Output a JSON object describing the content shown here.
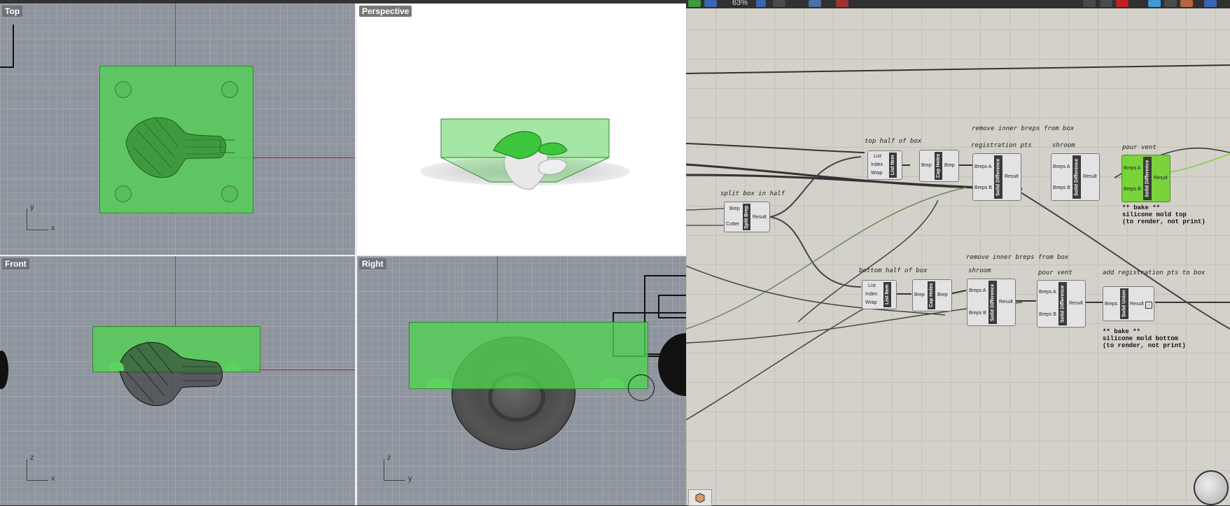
{
  "viewports": {
    "top": {
      "label": "Top",
      "axis1": "y",
      "axis2": "x"
    },
    "perspective": {
      "label": "Perspective"
    },
    "front": {
      "label": "Front",
      "axis1": "z",
      "axis2": "x"
    },
    "right": {
      "label": "Right",
      "axis1": "z",
      "axis2": "y"
    }
  },
  "toolbar": {
    "zoom": "63%"
  },
  "notes": {
    "remove_inner_top": "remove inner breps from box",
    "top_half": "top half of box",
    "registration_pts": "registration pts",
    "shroom_top": "shroom",
    "pour_vent_top": "pour vent",
    "split_box": "split box in half",
    "remove_inner_bottom": "remove inner breps from box",
    "bottom_half": "bottom half of box",
    "shroom_bottom": "shroom",
    "pour_vent_bottom": "pour vent",
    "add_registration": "add registration pts to box",
    "bake_top": "** bake **\nsilicone mold top\n(to render, not print)",
    "bake_bottom": "** bake **\nsilicone mold bottom\n(to render, not print)"
  },
  "components": {
    "split_brep": {
      "name": "Split Brep",
      "in1": "Brep",
      "in2": "Cutter",
      "out": "Result"
    },
    "list_item_top": {
      "name": "List Item",
      "in1": "List",
      "in2": "Index",
      "in3": "Wrap"
    },
    "cap_holes_top": {
      "name": "Cap Holes",
      "in": "Brep",
      "out": "Brep"
    },
    "solid_diff_1": {
      "name": "Solid Difference",
      "in1": "Breps A",
      "in2": "Breps B",
      "out": "Result"
    },
    "solid_diff_2": {
      "name": "Solid Difference",
      "in1": "Breps A",
      "in2": "Breps B",
      "out": "Result"
    },
    "solid_diff_3": {
      "name": "Solid Difference",
      "in1": "Breps A",
      "in2": "Breps B",
      "out": "Result"
    },
    "list_item_bottom": {
      "name": "List Item",
      "in1": "List",
      "in2": "Index",
      "in3": "Wrap"
    },
    "cap_holes_bottom": {
      "name": "Cap Holes",
      "in": "Brep",
      "out": "Brep"
    },
    "solid_diff_4": {
      "name": "Solid Difference",
      "in1": "Breps A",
      "in2": "Breps B",
      "out": "Result"
    },
    "solid_diff_5": {
      "name": "Solid Difference",
      "in1": "Breps A",
      "in2": "Breps B",
      "out": "Result"
    },
    "solid_union": {
      "name": "Solid Union",
      "in": "Breps",
      "out": "Result"
    }
  },
  "colors": {
    "selection_green": "#5fd65f",
    "gh_canvas": "#d4d1ca",
    "viewport_grid": "#8f959e"
  }
}
